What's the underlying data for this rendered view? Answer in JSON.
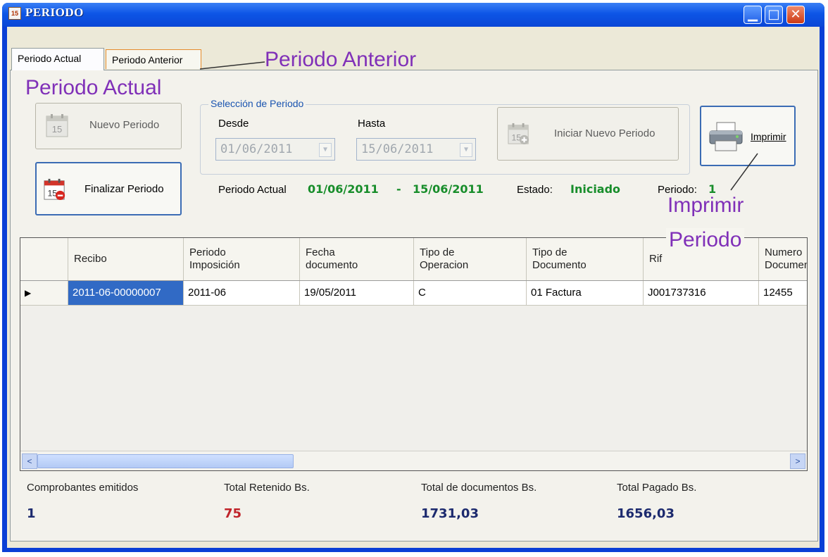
{
  "window": {
    "title": "PERIODO",
    "title_icon_text": "15",
    "minimize_glyph": "▁",
    "maximize_glyph": "□",
    "close_glyph": "✕"
  },
  "tabs": [
    {
      "label": "Periodo Actual",
      "selected": true
    },
    {
      "label": "Periodo Anterior",
      "selected": false
    }
  ],
  "annotations": {
    "periodo_anterior": "Periodo Anterior",
    "periodo_actual": "Periodo Actual",
    "imprimir_line1": "Imprimir",
    "imprimir_line2": "Periodo"
  },
  "toolbar": {
    "nuevo_periodo": "Nuevo Periodo",
    "finalizar_periodo": "Finalizar Periodo",
    "iniciar_nuevo_periodo": "Iniciar Nuevo Periodo",
    "imprimir": "Imprimir",
    "calendar_number": "15"
  },
  "seleccion": {
    "legend": "Selección de Periodo",
    "desde_label": "Desde",
    "desde_value": "01/06/2011",
    "hasta_label": "Hasta",
    "hasta_value": "15/06/2011"
  },
  "status": {
    "periodo_actual_label": "Periodo Actual",
    "desde": "01/06/2011",
    "sep": "-",
    "hasta": "15/06/2011",
    "estado_label": "Estado:",
    "estado_value": "Iniciado",
    "periodo_label": "Periodo:",
    "periodo_value": "1"
  },
  "grid": {
    "columns": [
      {
        "label": "Recibo"
      },
      {
        "label": "Periodo\nImposición"
      },
      {
        "label": "Fecha\ndocumento"
      },
      {
        "label": "Tipo de\nOperacion"
      },
      {
        "label": "Tipo de\nDocumento"
      },
      {
        "label": "Rif"
      },
      {
        "label": "Numero\nDocumento"
      }
    ],
    "rows": [
      [
        "2011-06-00000007",
        "2011-06",
        "19/05/2011",
        "C",
        "01 Factura",
        "J001737316",
        "12455"
      ]
    ],
    "row_marker": "▶",
    "scroll_left": "<",
    "scroll_right": ">"
  },
  "totals": {
    "comprobantes_label": "Comprobantes emitidos",
    "comprobantes_value": "1",
    "retenido_label": "Total Retenido Bs.",
    "retenido_value": "75",
    "documentos_label": "Total de documentos Bs.",
    "documentos_value": "1731,03",
    "pagado_label": "Total Pagado Bs.",
    "pagado_value": "1656,03"
  },
  "colors": {
    "green": "#178d2a",
    "red": "#c0242a",
    "navy": "#1c2a6e",
    "annotation": "#8030b8"
  }
}
